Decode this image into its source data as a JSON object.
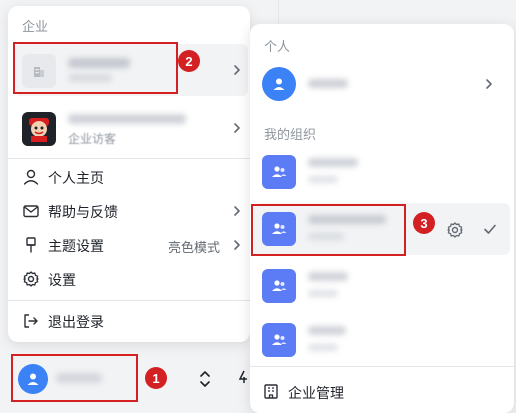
{
  "left_panel": {
    "section_label": "企业",
    "orgs": [
      {
        "name": "",
        "subtitle": ""
      },
      {
        "name": "",
        "subtitle": "企业访客"
      }
    ],
    "menu": [
      {
        "label": "个人主页",
        "icon": "user-icon"
      },
      {
        "label": "帮助与反馈",
        "icon": "mail-icon"
      },
      {
        "label": "主题设置",
        "icon": "brush-icon",
        "value": "亮色模式"
      },
      {
        "label": "设置",
        "icon": "gear-icon"
      },
      {
        "label": "退出登录",
        "icon": "logout-icon"
      }
    ]
  },
  "right_panel": {
    "personal_label": "个人",
    "personal_name": "",
    "orgs_label": "我的组织",
    "orgs": [
      {
        "name": ""
      },
      {
        "name": "",
        "selected": true
      },
      {
        "name": ""
      },
      {
        "name": ""
      }
    ],
    "footer_label": "企业管理"
  },
  "annotations": {
    "badge1": "1",
    "badge2": "2",
    "badge3": "3"
  },
  "colors": {
    "accent": "#3b82f6",
    "org_avatar": "#5b7cf4",
    "annotation": "#d32023"
  }
}
